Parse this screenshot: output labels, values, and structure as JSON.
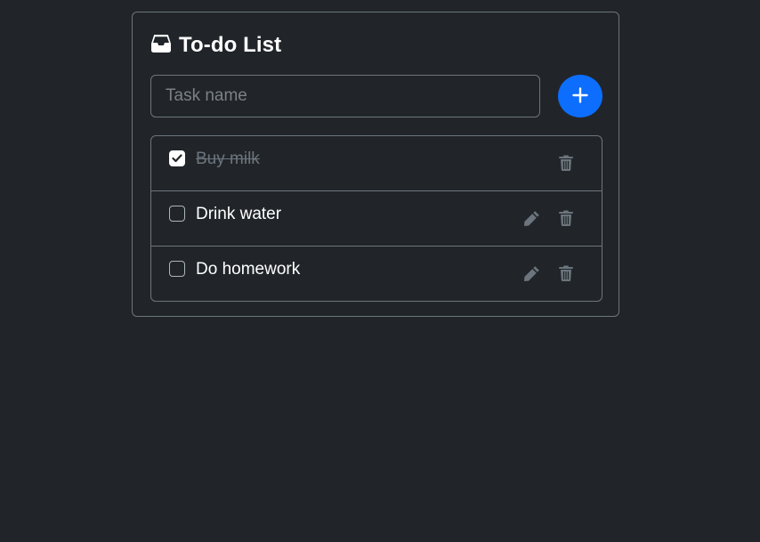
{
  "app": {
    "title": "To-do List",
    "title_icon": "inbox-tray-icon"
  },
  "new_task": {
    "placeholder": "Task name",
    "value": "",
    "add_button_icon": "plus-icon",
    "add_button_color": "#0d6efd"
  },
  "tasks": [
    {
      "label": "Buy milk",
      "done": true,
      "editable": false
    },
    {
      "label": "Drink water",
      "done": false,
      "editable": true
    },
    {
      "label": "Do homework",
      "done": false,
      "editable": true
    }
  ],
  "colors": {
    "background": "#212529",
    "border": "#6c757d",
    "muted_text": "#6c757d",
    "icon": "#6c757d"
  }
}
